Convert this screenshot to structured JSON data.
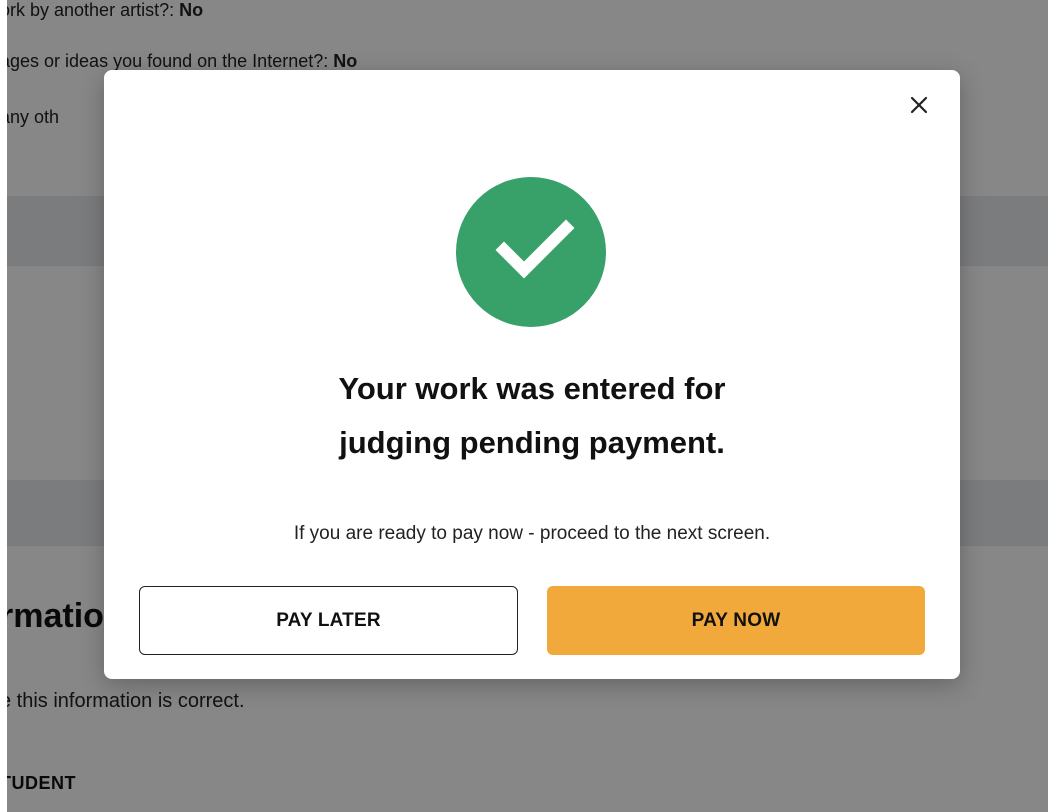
{
  "background": {
    "q1_text": "ork by another artist?:",
    "q1_answer": "No",
    "q2_text": "ages or ideas you found on the Internet?:",
    "q2_answer": "No",
    "q3_text": "any oth",
    "section_heading": "rmatio",
    "confirm_text": "e this information is correct.",
    "student_label": "TUDENT"
  },
  "modal": {
    "close_icon": "close-icon",
    "status_icon": "check-circle-icon",
    "status_color": "#38a169",
    "title_line1": "Your work was entered for",
    "title_line2": "judging pending payment.",
    "message": "If you are ready to pay now - proceed to the next screen.",
    "pay_later_label": "PAY LATER",
    "pay_now_label": "PAY NOW",
    "pay_now_color": "#f0a93a"
  }
}
